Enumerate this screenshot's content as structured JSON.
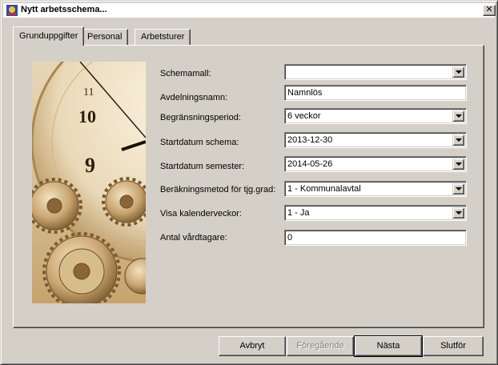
{
  "window": {
    "title": "Nytt arbetsschema...",
    "close_glyph": "✕"
  },
  "tabs": [
    {
      "label": "Grunduppgifter",
      "active": true
    },
    {
      "label": "Personal",
      "active": false
    },
    {
      "label": "Arbetsturer",
      "active": false
    }
  ],
  "form": {
    "schemamall": {
      "label": "Schemamall:",
      "value": ""
    },
    "avdelningsnamn": {
      "label": "Avdelningsnamn:",
      "value": "Namnlös"
    },
    "begransningsperiod": {
      "label": "Begränsningsperiod:",
      "value": "6  veckor"
    },
    "startdatum_schema": {
      "label": "Startdatum schema:",
      "value": "2013-12-30"
    },
    "startdatum_semester": {
      "label": "Startdatum semester:",
      "value": "2014-05-26"
    },
    "berakningsmetod": {
      "label": "Beräkningsmetod för tjg.grad:",
      "value": "1 - Kommunalavtal"
    },
    "visa_kalenderveckor": {
      "label": "Visa kalenderveckor:",
      "value": "1 - Ja"
    },
    "antal_vardtagare": {
      "label": "Antal vårdtagare:",
      "value": "0"
    }
  },
  "buttons": {
    "cancel": "Avbryt",
    "previous": "Föregående",
    "next": "Nästa",
    "finish": "Slutför"
  },
  "picture": {
    "clock_numbers": [
      "11",
      "10",
      "9"
    ]
  },
  "colors": {
    "dialog_bg": "#d4d0c8",
    "picture_tone": "#c7a46d"
  }
}
